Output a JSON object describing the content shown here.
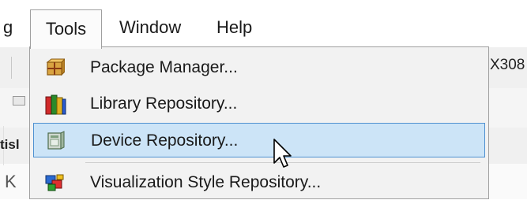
{
  "menubar": {
    "cut_left": "g",
    "items": [
      {
        "label": "Tools"
      },
      {
        "label": "Window"
      },
      {
        "label": "Help"
      }
    ]
  },
  "background": {
    "right_text": "X308",
    "left_text_row3": "tisl",
    "left_text_row4": "K"
  },
  "dropdown": {
    "items": [
      {
        "label": "Package Manager...",
        "icon": "package-icon"
      },
      {
        "label": "Library Repository...",
        "icon": "library-books-icon"
      },
      {
        "label": "Device Repository...",
        "icon": "device-icon",
        "highlighted": true
      },
      {
        "label": "Visualization Style Repository...",
        "icon": "visualization-style-icon"
      }
    ]
  },
  "colors": {
    "highlight_bg": "#cce4f7",
    "highlight_border": "#4f91d1",
    "menu_bg": "#f2f2f2"
  }
}
